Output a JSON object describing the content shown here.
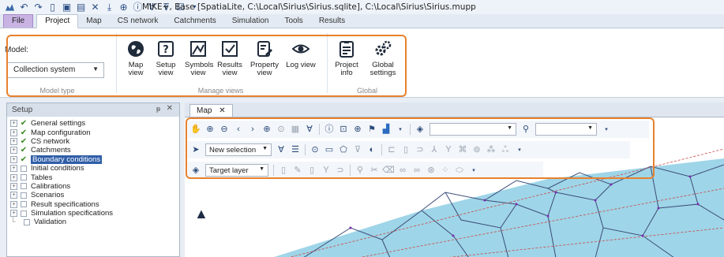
{
  "title": "MIKE+, Base [SpatiaLite, C:\\Local\\Sirius\\Sirius.sqlite], C:\\Local\\Sirius\\Sirius.mupp",
  "quick_access_icons": [
    "app-logo",
    "undo",
    "redo",
    "new",
    "open",
    "save",
    "close",
    "import",
    "globe",
    "info",
    "filter",
    "clear-filter",
    "validate",
    "dropdown"
  ],
  "tabs": [
    "File",
    "Project",
    "Map",
    "CS network",
    "Catchments",
    "Simulation",
    "Tools",
    "Results"
  ],
  "active_tab": "Project",
  "ribbon": {
    "model_type": {
      "label": "Model:",
      "selected": "Collection system",
      "group_label": "Model type"
    },
    "manage_views": {
      "group_label": "Manage views",
      "buttons": [
        {
          "label": "Map view",
          "icon": "globe-icon"
        },
        {
          "label": "Setup view",
          "icon": "help-box-icon"
        },
        {
          "label": "Symbols view",
          "icon": "symbols-icon"
        },
        {
          "label": "Results view",
          "icon": "checkbox-icon"
        },
        {
          "label": "Property view",
          "icon": "property-icon"
        },
        {
          "label": "Log view",
          "icon": "eye-icon"
        }
      ]
    },
    "global": {
      "group_label": "Global",
      "buttons": [
        {
          "label": "Project info",
          "icon": "document-icon"
        },
        {
          "label": "Global settings",
          "icon": "settings-icon"
        }
      ]
    }
  },
  "setup_panel": {
    "title": "Setup",
    "items": [
      {
        "label": "General settings",
        "checked": true
      },
      {
        "label": "Map configuration",
        "checked": true
      },
      {
        "label": "CS network",
        "checked": true
      },
      {
        "label": "Catchments",
        "checked": true
      },
      {
        "label": "Boundary conditions",
        "checked": true,
        "selected": true
      },
      {
        "label": "Initial conditions",
        "checked": false
      },
      {
        "label": "Tables",
        "checked": false
      },
      {
        "label": "Calibrations",
        "checked": false
      },
      {
        "label": "Scenarios",
        "checked": false
      },
      {
        "label": "Result specifications",
        "checked": false
      },
      {
        "label": "Simulation specifications",
        "checked": false
      },
      {
        "label": "Validation",
        "checked": false,
        "leaf": true
      }
    ]
  },
  "map": {
    "tab_label": "Map",
    "toolbar": {
      "selection_combo": "New selection",
      "layer_combo": "Target layer"
    }
  },
  "colors": {
    "highlight": "#e8812c",
    "selection": "#2f5ea8",
    "map_water": "#9fd5e8"
  }
}
